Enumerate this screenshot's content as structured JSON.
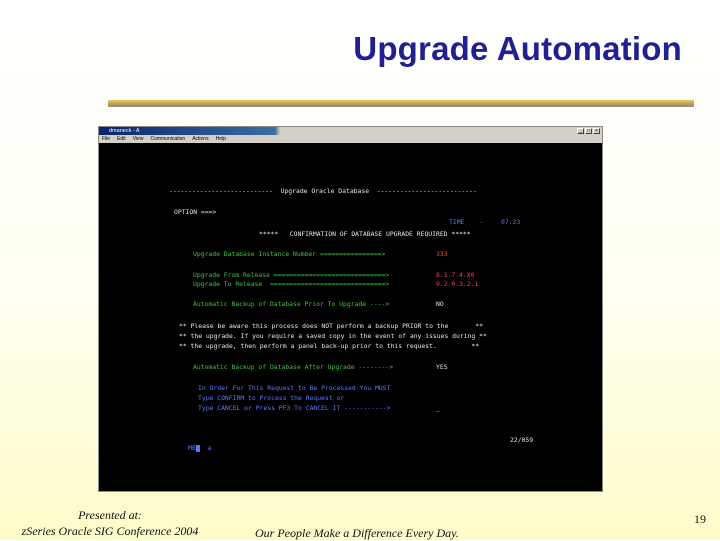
{
  "slide": {
    "title": "Upgrade Automation",
    "footer_left_line1": "Presented at:",
    "footer_left_line2": "zSeries Oracle SIG Conference 2004",
    "footer_center": "Our People Make a Difference Every Day.",
    "page_number": "19"
  },
  "window": {
    "title": "dmaneck - A",
    "controls": [
      "_",
      "□",
      "×"
    ],
    "menu": [
      "File",
      "Edit",
      "View",
      "Communication",
      "Actions",
      "Help"
    ]
  },
  "terminal": {
    "header": "---------------------------  Upgrade Oracle Database  --------------------------",
    "option_prompt": "OPTION ===>",
    "time_label": "TIME    -",
    "time_value": "07:23",
    "confirm_line": "*****   CONFIRMATION OF DATABASE UPGRADE REQUIRED *****",
    "instance_label": "Upgrade Database Instance Number ================>",
    "instance_value": "333",
    "from_label": "Upgrade From Release =============================>",
    "from_value": "8.1.7.4.X0",
    "to_label": "Upgrade To Release  ==============================>",
    "to_value": "9.2.0.3.2.1",
    "backup_prior_label": "Automatic Backup of Database Prior To Upgrade ---->",
    "backup_prior_value": "NO",
    "warn1": "** Please be aware this process does NOT perform a backup PRIOR to the       **",
    "warn2": "** the upgrade. If you require a saved copy in the event of any issues during **",
    "warn3": "** the upgrade, then perform a panel back-up prior to this request.         **",
    "backup_after_label": "Automatic Backup of Database After Upgrade -------->",
    "backup_after_value": "YES",
    "order1": "In Order For This Request to Be Processed You MUST",
    "order2": "Type CONFIRM to Process the Request or",
    "order3": "Type CANCEL or Press PF3 To CANCEL IT ----------->",
    "order3_cursor": "_",
    "status_left": "MB",
    "status_mode": "a",
    "status_pos": "22/059"
  }
}
